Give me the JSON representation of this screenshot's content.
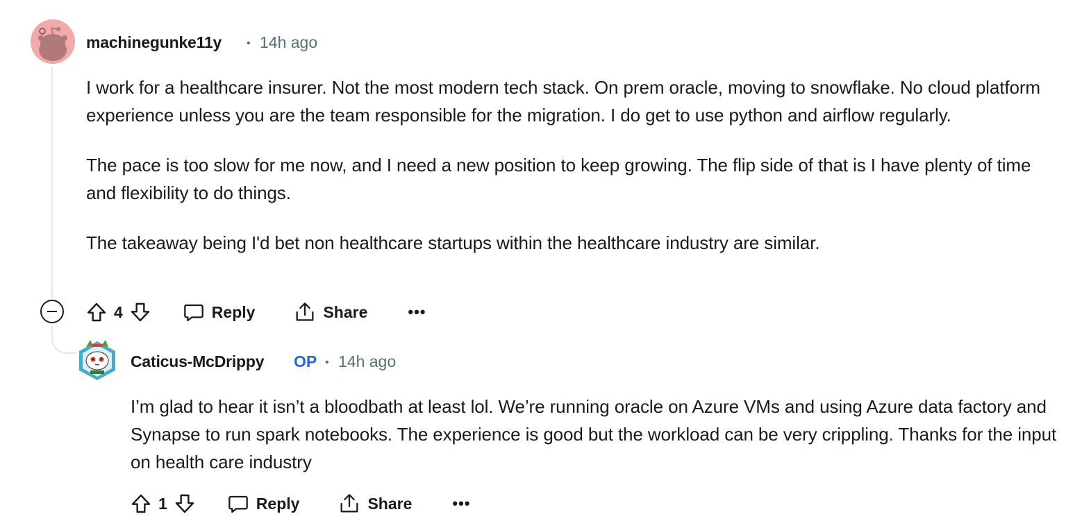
{
  "comments": [
    {
      "username": "machinegunke11y",
      "separator": "•",
      "time": "14h ago",
      "paragraphs": [
        "I work for a healthcare insurer. Not the most modern tech stack. On prem oracle, moving to snowflake. No cloud platform experience unless you are the team responsible for the migration. I do get to use python and airflow regularly.",
        "The pace is too slow for me now, and I need a new position to keep growing. The flip side of that is I have plenty of time and flexibility to do things.",
        "The takeaway being I'd bet non healthcare startups within the healthcare industry are similar."
      ],
      "vote_count": "4",
      "reply_label": "Reply",
      "share_label": "Share",
      "more_label": "•••"
    },
    {
      "username": "Caticus-McDrippy",
      "badge": "OP",
      "separator": "•",
      "time": "14h ago",
      "paragraphs": [
        "I’m glad to hear it isn’t a bloodbath at least lol. We’re running oracle on Azure VMs and using Azure data factory and Synapse to run spark notebooks. The experience is good but the workload can be very crippling. Thanks for the input on health care industry"
      ],
      "vote_count": "1",
      "reply_label": "Reply",
      "share_label": "Share",
      "more_label": "•••"
    }
  ],
  "colors": {
    "text": "#1a1a1b",
    "meta": "#576f76",
    "op_badge": "#2a66d1",
    "avatar_bg": "#f2a9a9",
    "thread_line": "#e5e8ea"
  },
  "icons": {
    "upvote": "upvote-arrow-icon",
    "downvote": "downvote-arrow-icon",
    "reply": "speech-bubble-icon",
    "share": "share-upload-icon",
    "collapse": "collapse-minus-icon",
    "avatar_1": "snoo-avatar-icon",
    "avatar_2": "custom-cat-avatar-icon"
  }
}
